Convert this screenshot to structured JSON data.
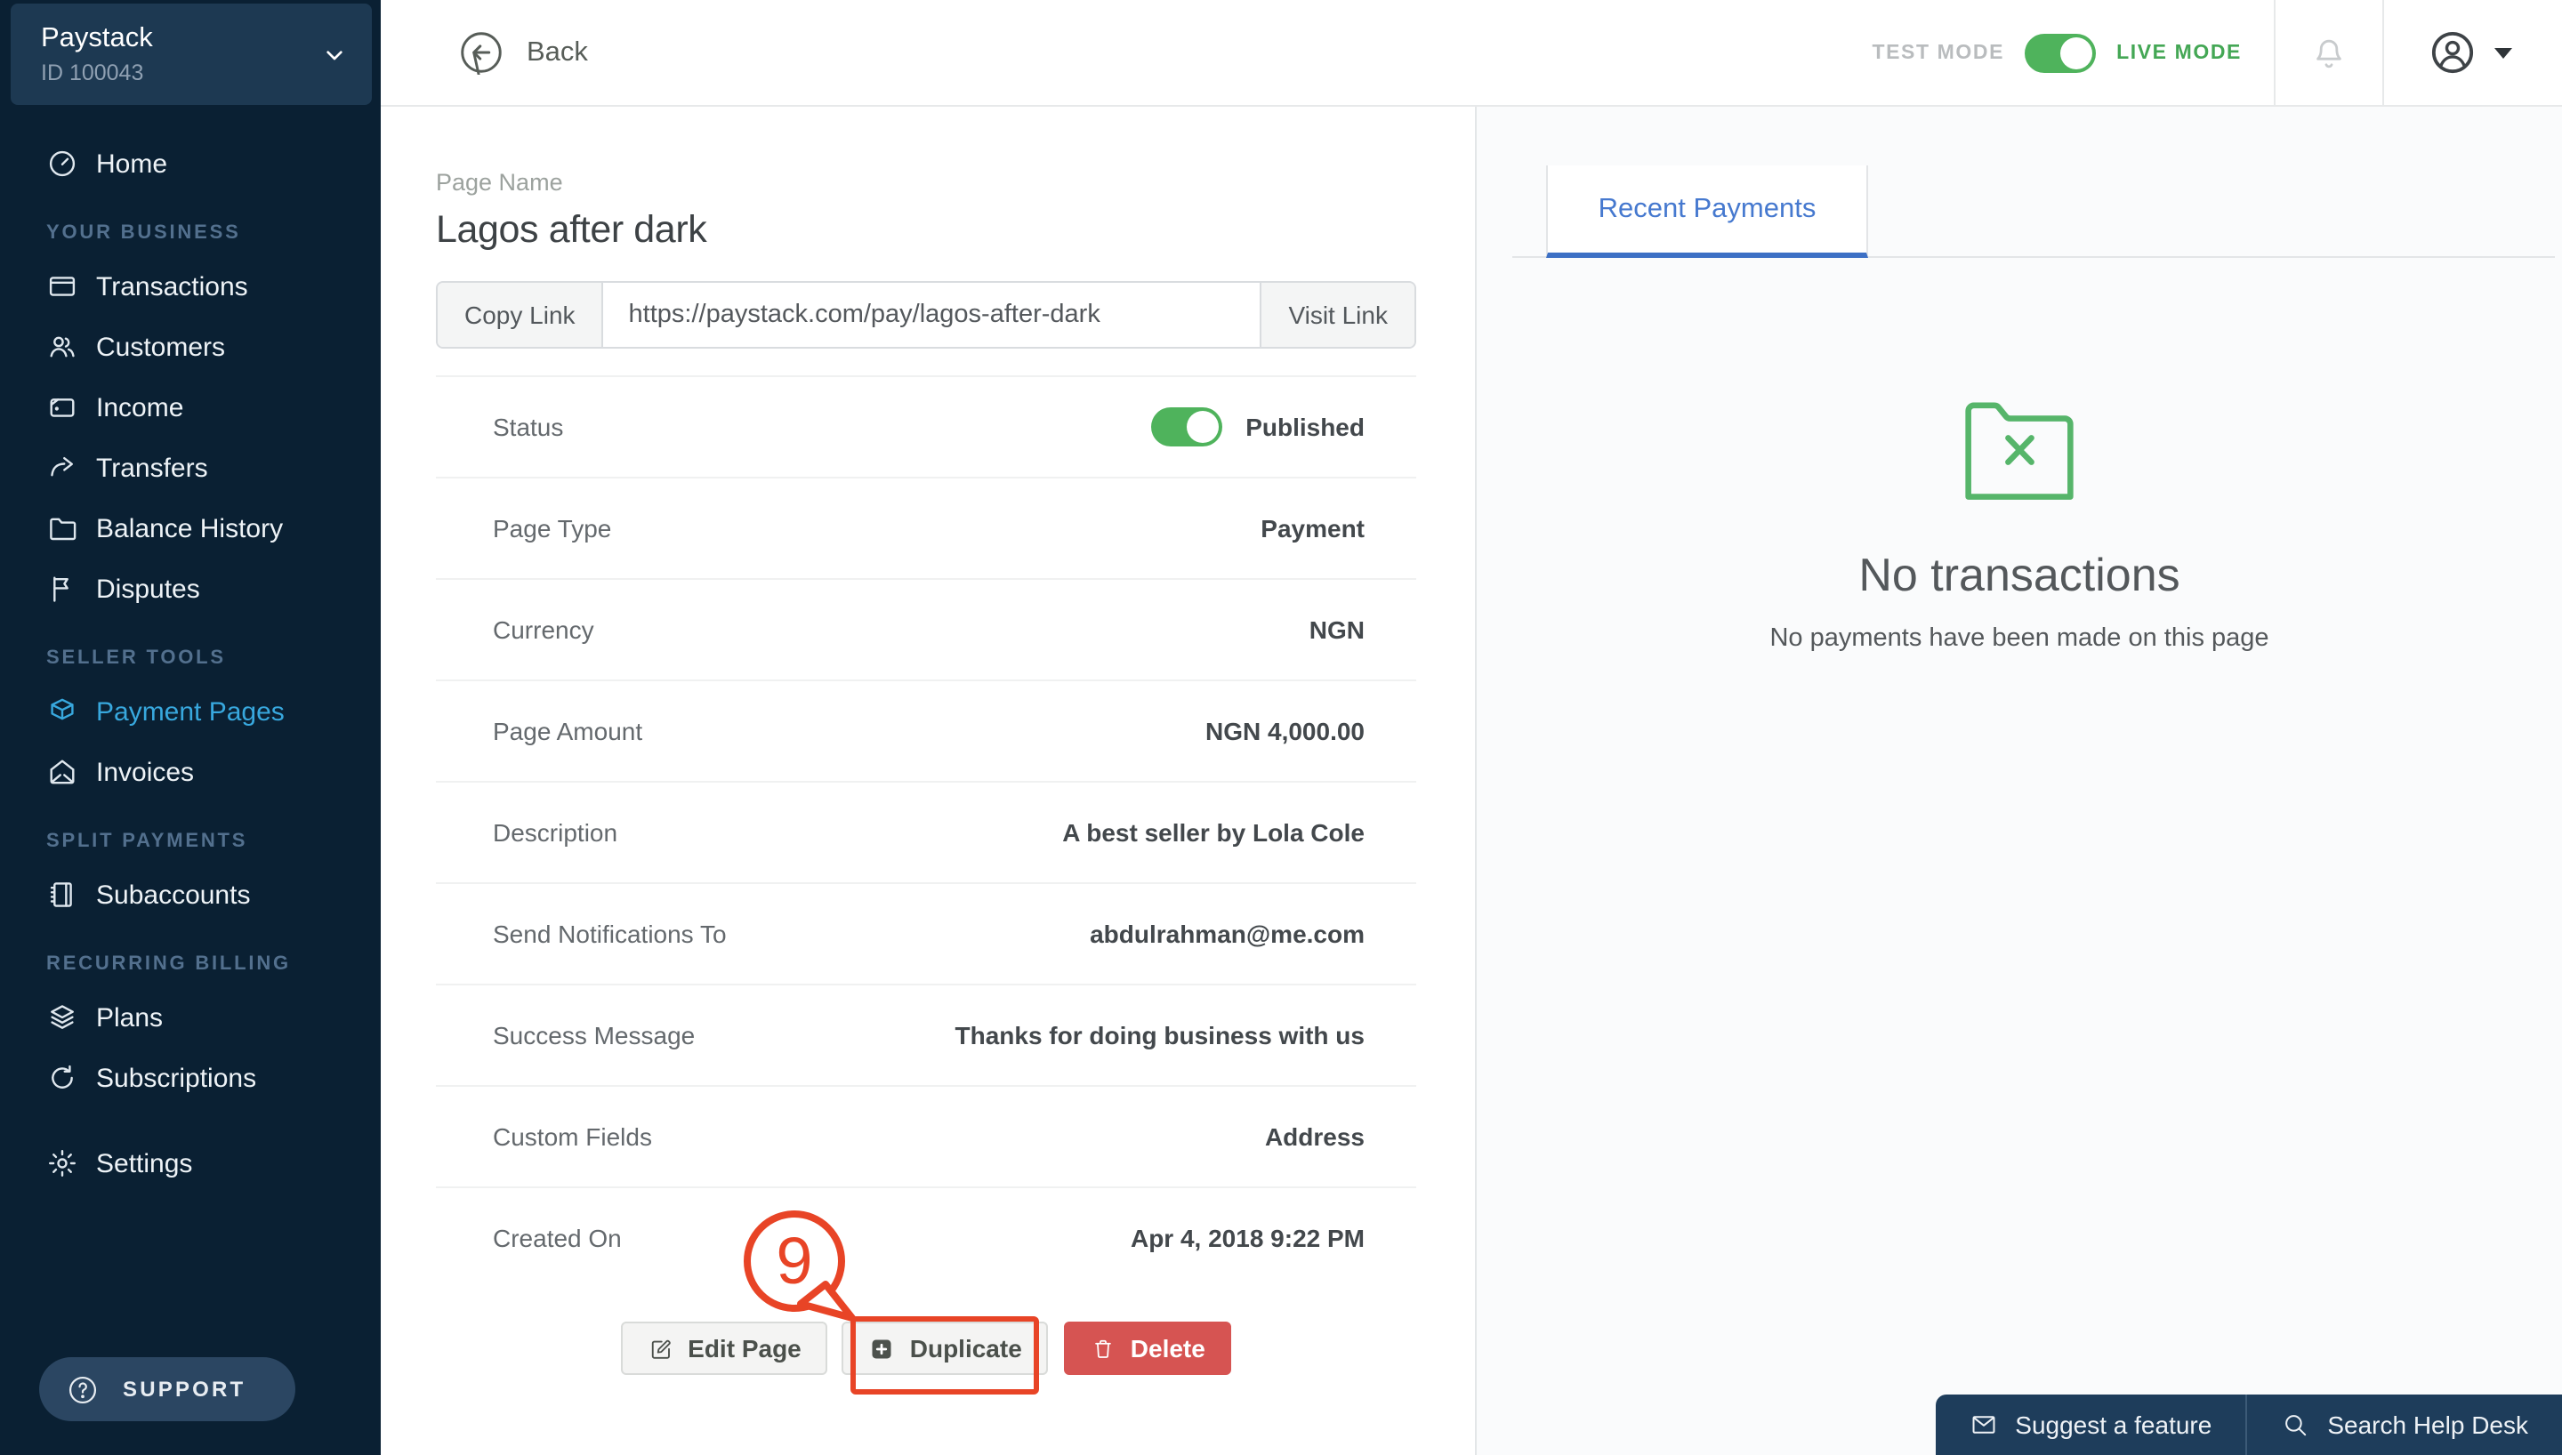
{
  "colors": {
    "sidebar_navy": "#0a2033",
    "accent_blue": "#38a8de",
    "tab_link_blue": "#4679cf",
    "toggle_green": "#4fb35c",
    "live_mode_green": "#44a755",
    "danger_red": "#d65452",
    "annotation_red": "#e84426",
    "empty_folder_green": "#56b56a"
  },
  "sidebar": {
    "org": {
      "name": "Paystack",
      "id": "ID 100043"
    },
    "sections": [
      {
        "label": "",
        "items": [
          {
            "label": "Home",
            "icon": "home-icon",
            "active": false
          }
        ]
      },
      {
        "label": "YOUR BUSINESS",
        "items": [
          {
            "label": "Transactions",
            "icon": "transactions-icon",
            "active": false
          },
          {
            "label": "Customers",
            "icon": "customers-icon",
            "active": false
          },
          {
            "label": "Income",
            "icon": "income-icon",
            "active": false
          },
          {
            "label": "Transfers",
            "icon": "transfers-icon",
            "active": false
          },
          {
            "label": "Balance History",
            "icon": "balance-history-icon",
            "active": false
          },
          {
            "label": "Disputes",
            "icon": "disputes-icon",
            "active": false
          }
        ]
      },
      {
        "label": "SELLER TOOLS",
        "items": [
          {
            "label": "Payment Pages",
            "icon": "payment-pages-icon",
            "active": true
          },
          {
            "label": "Invoices",
            "icon": "invoices-icon",
            "active": false
          }
        ]
      },
      {
        "label": "SPLIT PAYMENTS",
        "items": [
          {
            "label": "Subaccounts",
            "icon": "subaccounts-icon",
            "active": false
          }
        ]
      },
      {
        "label": "RECURRING BILLING",
        "items": [
          {
            "label": "Plans",
            "icon": "plans-icon",
            "active": false
          },
          {
            "label": "Subscriptions",
            "icon": "subscriptions-icon",
            "active": false
          }
        ]
      },
      {
        "label": "",
        "items": [
          {
            "label": "Settings",
            "icon": "settings-icon",
            "active": false
          }
        ]
      }
    ],
    "support_label": "SUPPORT"
  },
  "topbar": {
    "back_label": "Back",
    "test_mode_label": "TEST MODE",
    "live_mode_label": "LIVE MODE",
    "mode_toggle_state": "on"
  },
  "page": {
    "name_label": "Page Name",
    "title": "Lagos after dark",
    "copy_link_label": "Copy Link",
    "url": "https://paystack.com/pay/lagos-after-dark",
    "visit_link_label": "Visit Link",
    "rows": [
      {
        "label": "Status",
        "value": "Published",
        "type": "toggle"
      },
      {
        "label": "Page Type",
        "value": "Payment",
        "type": "text"
      },
      {
        "label": "Currency",
        "value": "NGN",
        "type": "text"
      },
      {
        "label": "Page Amount",
        "value": "NGN 4,000.00",
        "type": "text"
      },
      {
        "label": "Description",
        "value": "A best seller by Lola Cole",
        "type": "text"
      },
      {
        "label": "Send Notifications To",
        "value": "abdulrahman@me.com",
        "type": "text"
      },
      {
        "label": "Success Message",
        "value": "Thanks for doing business with us",
        "type": "text"
      },
      {
        "label": "Custom Fields",
        "value": "Address",
        "type": "text"
      },
      {
        "label": "Created On",
        "value": "Apr 4, 2018 9:22 PM",
        "type": "text"
      }
    ],
    "actions": {
      "edit": "Edit Page",
      "duplicate": "Duplicate",
      "delete": "Delete"
    },
    "annotation": "9"
  },
  "payments_panel": {
    "tab": "Recent Payments",
    "empty_title": "No transactions",
    "empty_subtitle": "No payments have been made on this page"
  },
  "help_bar": {
    "suggest": "Suggest a feature",
    "search": "Search Help Desk"
  }
}
